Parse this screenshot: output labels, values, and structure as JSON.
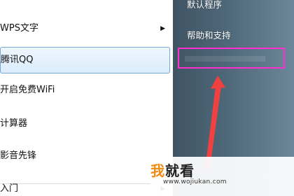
{
  "start_menu": {
    "programs": [
      {
        "label": "WPS文字",
        "has_submenu": true
      },
      {
        "label": "腾讯QQ",
        "selected": true
      },
      {
        "label": "开启免费WiFi"
      },
      {
        "label": "计算器"
      },
      {
        "label": "影音先锋"
      },
      {
        "label": "入门",
        "has_submenu": true
      }
    ],
    "submenu_arrow": "▶",
    "right_links": [
      {
        "label": "默认程序"
      },
      {
        "label": "帮助和支持"
      }
    ]
  },
  "annotation": {
    "highlight_color": "#ff2ed0",
    "arrow_color": "#f04040"
  },
  "watermark": {
    "brand_first": "我",
    "brand_rest": "就看",
    "url": "www.wojiukan.com"
  }
}
